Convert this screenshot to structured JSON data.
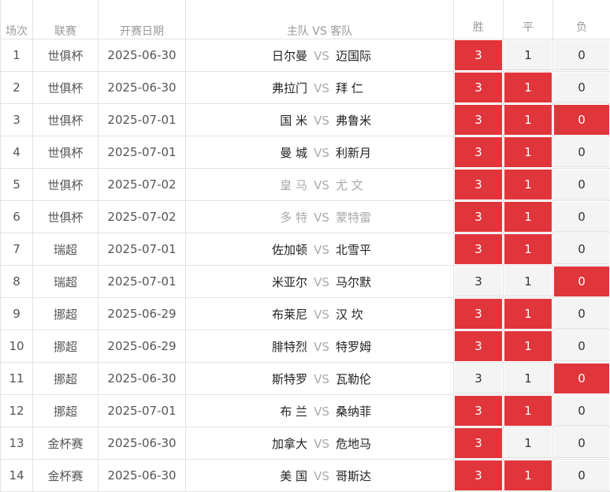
{
  "header": {
    "col_round": "场次",
    "col_league": "联赛",
    "col_date": "开赛日期",
    "col_match": "主队 VS 客队",
    "col_win": "胜",
    "col_draw": "平",
    "col_loss": "负",
    "vs": "VS"
  },
  "rows": [
    {
      "no": "1",
      "league": "世俱杯",
      "date": "2025-06-30",
      "home": "日尔曼",
      "away": "迈国际",
      "win": "3",
      "draw": "1",
      "loss": "0",
      "sel": [
        true,
        false,
        false
      ],
      "grey": false
    },
    {
      "no": "2",
      "league": "世俱杯",
      "date": "2025-06-30",
      "home": "弗拉门",
      "away": "拜 仁",
      "win": "3",
      "draw": "1",
      "loss": "0",
      "sel": [
        true,
        true,
        false
      ],
      "grey": false
    },
    {
      "no": "3",
      "league": "世俱杯",
      "date": "2025-07-01",
      "home": "国 米",
      "away": "弗鲁米",
      "win": "3",
      "draw": "1",
      "loss": "0",
      "sel": [
        true,
        true,
        true
      ],
      "grey": false
    },
    {
      "no": "4",
      "league": "世俱杯",
      "date": "2025-07-01",
      "home": "曼 城",
      "away": "利新月",
      "win": "3",
      "draw": "1",
      "loss": "0",
      "sel": [
        true,
        true,
        false
      ],
      "grey": false
    },
    {
      "no": "5",
      "league": "世俱杯",
      "date": "2025-07-02",
      "home": "皇 马",
      "away": "尤 文",
      "win": "3",
      "draw": "1",
      "loss": "0",
      "sel": [
        true,
        true,
        false
      ],
      "grey": true
    },
    {
      "no": "6",
      "league": "世俱杯",
      "date": "2025-07-02",
      "home": "多 特",
      "away": "蒙特雷",
      "win": "3",
      "draw": "1",
      "loss": "0",
      "sel": [
        true,
        true,
        false
      ],
      "grey": true
    },
    {
      "no": "7",
      "league": "瑞超",
      "date": "2025-07-01",
      "home": "佐加顿",
      "away": "北雪平",
      "win": "3",
      "draw": "1",
      "loss": "0",
      "sel": [
        true,
        true,
        false
      ],
      "grey": false
    },
    {
      "no": "8",
      "league": "瑞超",
      "date": "2025-07-01",
      "home": "米亚尔",
      "away": "马尔默",
      "win": "3",
      "draw": "1",
      "loss": "0",
      "sel": [
        false,
        false,
        true
      ],
      "grey": false
    },
    {
      "no": "9",
      "league": "挪超",
      "date": "2025-06-29",
      "home": "布莱尼",
      "away": "汉 坎",
      "win": "3",
      "draw": "1",
      "loss": "0",
      "sel": [
        true,
        true,
        false
      ],
      "grey": false
    },
    {
      "no": "10",
      "league": "挪超",
      "date": "2025-06-29",
      "home": "腓特烈",
      "away": "特罗姆",
      "win": "3",
      "draw": "1",
      "loss": "0",
      "sel": [
        true,
        true,
        false
      ],
      "grey": false
    },
    {
      "no": "11",
      "league": "挪超",
      "date": "2025-06-30",
      "home": "斯特罗",
      "away": "瓦勒伦",
      "win": "3",
      "draw": "1",
      "loss": "0",
      "sel": [
        false,
        false,
        true
      ],
      "grey": false
    },
    {
      "no": "12",
      "league": "挪超",
      "date": "2025-07-01",
      "home": "布 兰",
      "away": "桑纳菲",
      "win": "3",
      "draw": "1",
      "loss": "0",
      "sel": [
        true,
        true,
        false
      ],
      "grey": false
    },
    {
      "no": "13",
      "league": "金杯赛",
      "date": "2025-06-30",
      "home": "加拿大",
      "away": "危地马",
      "win": "3",
      "draw": "1",
      "loss": "0",
      "sel": [
        true,
        false,
        false
      ],
      "grey": false
    },
    {
      "no": "14",
      "league": "金杯赛",
      "date": "2025-06-30",
      "home": "美 国",
      "away": "哥斯达",
      "win": "3",
      "draw": "1",
      "loss": "0",
      "sel": [
        true,
        true,
        false
      ],
      "grey": false
    }
  ]
}
